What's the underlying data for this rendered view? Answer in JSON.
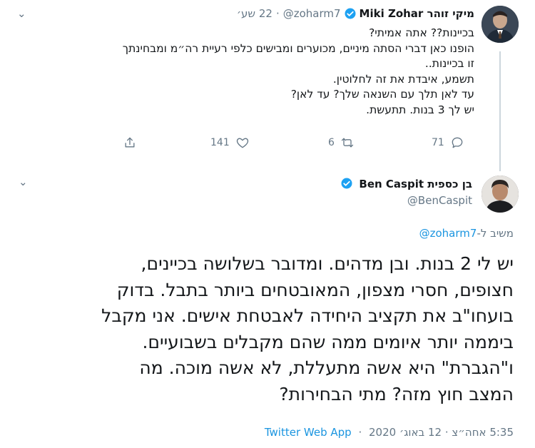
{
  "tweet1": {
    "display_name": "מיקי זוהר Miki Zohar",
    "handle": "@zoharm7",
    "time": "22 שע׳",
    "lines": [
      "בכיינות?? אתה אמיתי?",
      "הופנו כאן דברי הסתה מיניים, מכוערים ומבישים כלפי רעיית רה״מ ומבחינתך",
      "זו בכיינות..",
      "תשמע, איבדת את זה לחלוטין.",
      "עד לאן תלך עם השנאה שלך? עד לאן?",
      "יש לך 3 בנות. תתעשת."
    ],
    "replies": "71",
    "retweets": "6",
    "likes": "141"
  },
  "tweet2": {
    "display_name": "בן כספית Ben Caspit",
    "handle": "@BenCaspit",
    "replying_prefix": "משיב ל-",
    "replying_to": "@zoharm7",
    "lines": [
      "יש לי 2 בנות. ובן מדהים. ומדובר בשלושה בכיינים,",
      "חצופים, חסרי מצפון, המאובטחים ביותר בתבל. בדוק",
      "בועחו\"ב את תקציב היחידה לאבטחת אישים. אני מקבל",
      "ביממה יותר איומים ממה שהם מקבלים בשבועיים.",
      "ו\"הגברת\" היא אשה מתעללת, לא אשה מוכה. מה",
      "המצב חוץ מזה? מתי הבחירות?"
    ],
    "timestamp": "5:35 אחה״צ · 12 באוג׳ 2020",
    "source": "Twitter Web App"
  },
  "ui": {
    "separator": "·",
    "chevron": "⌄"
  },
  "colors": {
    "accent": "#1b95e0",
    "muted": "#657786",
    "verified": "#1da1f2",
    "thread_line": "#ccd6dd"
  },
  "icons": [
    "chevron-down-icon",
    "verified-badge-icon",
    "reply-icon",
    "retweet-icon",
    "like-icon",
    "share-icon"
  ]
}
